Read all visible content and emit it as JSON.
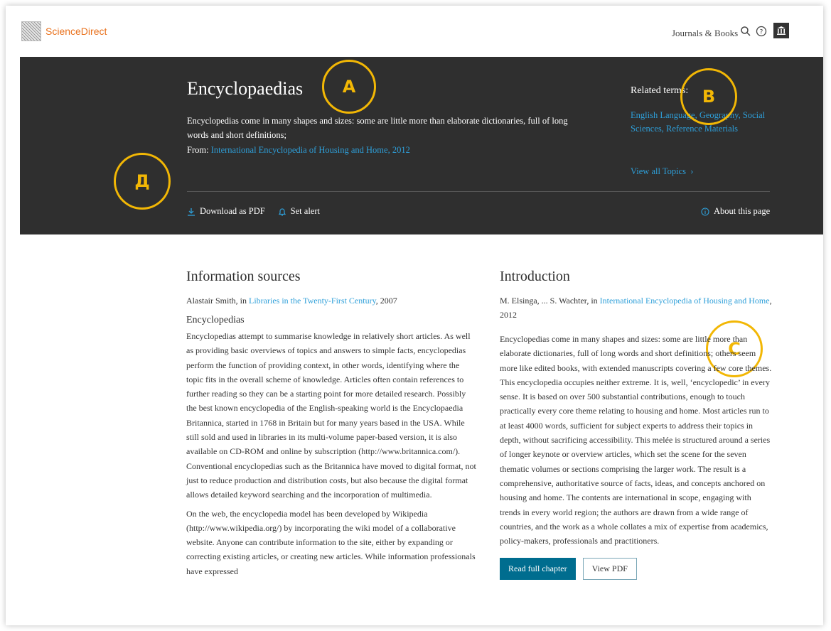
{
  "header": {
    "brand": "ScienceDirect",
    "nav_link": "Journals & Books",
    "icons": [
      "search-icon",
      "help-icon",
      "institution-icon"
    ]
  },
  "hero": {
    "title": "Encyclopaedias",
    "description": "Encyclopedias come in many shapes and sizes: some are little more than elaborate dictionaries, full of long words and short definitions;",
    "from_label": "From:",
    "from_source": "International Encyclopedia of Housing and Home, 2012",
    "related_title": "Related terms:",
    "related_terms": [
      "English Language",
      "Geography",
      "Social Sciences",
      "Reference Materials"
    ],
    "view_all": "View all Topics",
    "download_label": "Download as PDF",
    "alert_label": "Set alert",
    "about_label": "About this page"
  },
  "annotations": {
    "a": "A",
    "b": "B",
    "c": "C",
    "d": "Д"
  },
  "left_column": {
    "heading": "Information sources",
    "author": "Alastair Smith, in",
    "source": "Libraries in the Twenty-First Century",
    "year": ", 2007",
    "subheading": "Encyclopedias",
    "para1": "Encyclopedias attempt to summarise knowledge in relatively short articles. As well as providing basic overviews of topics and answers to simple facts, encyclopedias perform the function of providing context, in other words, identifying where the topic fits in the overall scheme of knowledge. Articles often contain references to further reading so they can be a starting point for more detailed research. Possibly the best known encyclopedia of the English-speaking world is the Encyclopaedia Britannica, started in 1768 in Britain but for many years based in the USA. While still sold and used in libraries in its multi-volume paper-based version, it is also available on CD-ROM and online by subscription (http://www.britannica.com/). Conventional encyclopedias such as the Britannica have moved to digital format, not just to reduce production and distribution costs, but also because the digital format allows detailed keyword searching and the incorporation of multimedia.",
    "para2": "On the web, the encyclopedia model has been developed by Wikipedia (http://www.wikipedia.org/) by incorporating the wiki model of a collaborative website. Anyone can contribute information to the site, either by expanding or correcting existing articles, or creating new articles. While information professionals have expressed"
  },
  "right_column": {
    "heading": "Introduction",
    "author": "M. Elsinga, ... S. Wachter, in",
    "source": "International Encyclopedia of Housing and Home",
    "year": ", 2012",
    "para": "Encyclopedias come in many shapes and sizes: some are little more than elaborate dictionaries, full of long words and short definitions; others seem more like edited books, with extended manuscripts covering a few core themes. This encyclopedia occupies neither extreme. It is, well, ‘encyclopedic’ in every sense. It is based on over 500 substantial contributions, enough to touch practically every core theme relating to housing and home. Most articles run to at least 4000 words, sufficient for subject experts to address their topics in depth, without sacrificing accessibility. This melée is structured around a series of longer keynote or overview articles, which set the scene for the seven thematic volumes or sections comprising the larger work. The result is a comprehensive, authoritative source of facts, ideas, and concepts anchored on housing and home. The contents are international in scope, engaging with trends in every world region; the authors are drawn from a wide range of countries, and the work as a whole collates a mix of expertise from academics, policy-makers, professionals and practitioners.",
    "read_button": "Read full chapter",
    "pdf_button": "View PDF"
  },
  "colors": {
    "brand": "#e9711c",
    "hero_bg": "#2f2f2f",
    "link": "#2e9fd9",
    "primary_button": "#006d8f",
    "annotation": "#f2b705"
  }
}
